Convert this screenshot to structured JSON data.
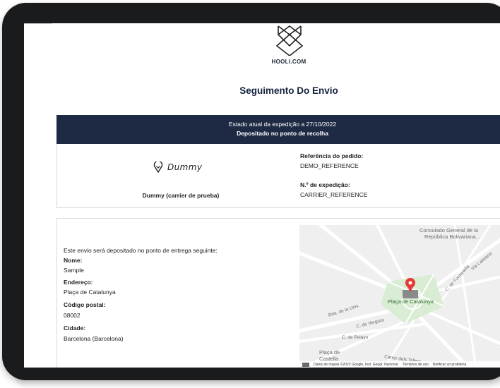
{
  "header": {
    "brand": "HOOLI.COM",
    "title": "Seguimento Do Envio"
  },
  "status": {
    "line1": "Estado atual da expedição a 27/10/2022",
    "line2": "Depositado no ponto de recolha"
  },
  "carrier": {
    "logo_text": "Dummy",
    "name": "Dummy (carrier de prueba)",
    "order_ref_label": "Referência do pedido:",
    "order_ref_value": "DEMO_REFERENCE",
    "shipment_label": "N.º de expedição:",
    "shipment_value": "CARRIER_REFERENCE"
  },
  "delivery": {
    "intro": "Este envio será depositado no ponto de entrega seguinte:",
    "name_label": "Nome:",
    "name_value": "Sample",
    "address_label": "Endereço:",
    "address_value": "Plaça de Catalunya",
    "postal_label": "Código postal:",
    "postal_value": "08002",
    "city_label": "Cidade:",
    "city_value": "Barcelona (Barcelona)"
  },
  "map": {
    "labels": {
      "consulate": "Consulado General de la",
      "consulate2": "República Bolivariana...",
      "plaza": "Plaça de Catalunya",
      "univ": "Rda. de la Univ.",
      "vergara": "C. de Vergara",
      "pelayo": "C. de Pelayo",
      "fontanella": "C. de Fontanella",
      "layetana": "Via Laietana",
      "castella": "Plaça de Castella",
      "tallers": "Carrer dels Tallers"
    },
    "footer": {
      "data": "Datos de mapas ©2022 Google, Inst. Geogr. Nacional",
      "terms": "Términos de uso",
      "report": "Notificar un problema"
    },
    "colors": {
      "road": "#ffffff",
      "park": "#d9ecd4",
      "pin": "#e53935"
    }
  }
}
